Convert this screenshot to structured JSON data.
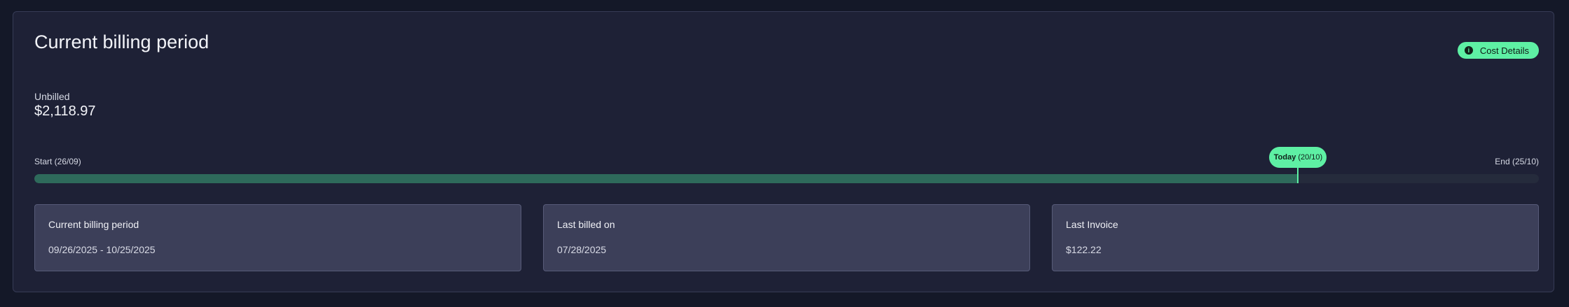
{
  "billing": {
    "title": "Current billing period",
    "cost_details_label": "Cost Details",
    "unbilled_label": "Unbilled",
    "unbilled_amount": "$2,118.97",
    "timeline": {
      "start_label": "Start (26/09)",
      "end_label": "End (25/10)",
      "today_word": "Today",
      "today_date": "(20/10)",
      "progress_fraction": 0.84
    }
  },
  "cards": [
    {
      "label": "Current billing period",
      "value": "09/26/2025 - 10/25/2025"
    },
    {
      "label": "Last billed on",
      "value": "07/28/2025"
    },
    {
      "label": "Last Invoice",
      "value": "$122.22"
    }
  ],
  "colors": {
    "accent": "#5ef0a4",
    "progress_fill": "#2e6a5b",
    "panel": "#1e2136",
    "card": "#3c3f59"
  },
  "icons": {
    "cost_details": "info-icon"
  }
}
